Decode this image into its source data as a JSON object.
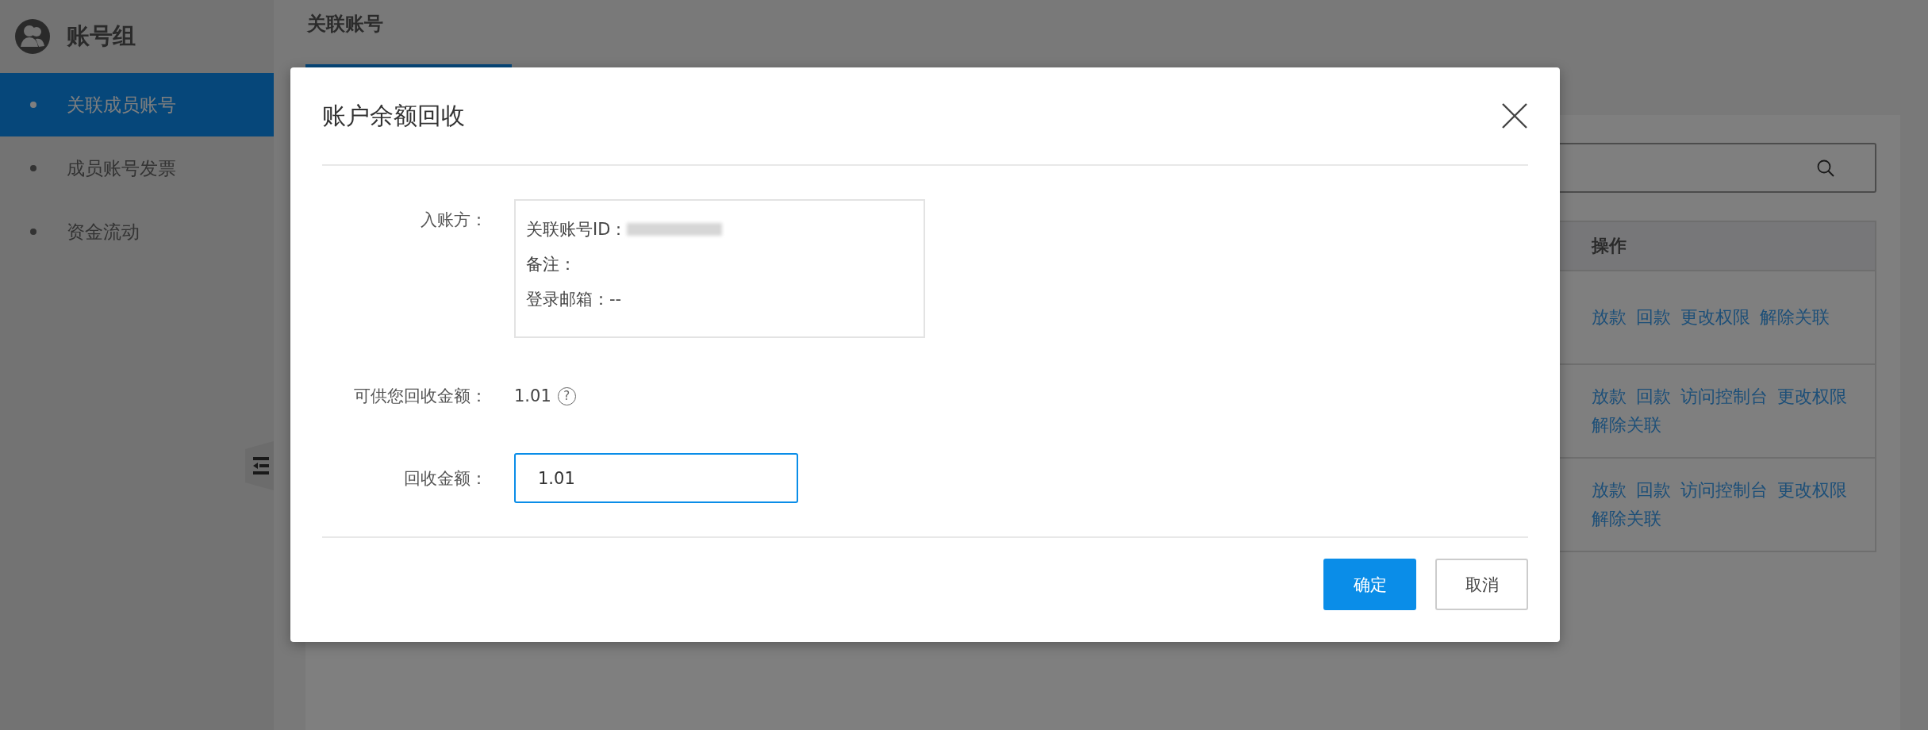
{
  "sidebar": {
    "title": "账号组",
    "items": [
      {
        "label": "关联成员账号",
        "selected": true
      },
      {
        "label": "成员账号发票",
        "selected": false
      },
      {
        "label": "资金流动",
        "selected": false
      }
    ]
  },
  "tabs": [
    {
      "label": "关联账号",
      "selected": true
    }
  ],
  "table": {
    "columns": [
      "操作"
    ],
    "rows": [
      {
        "actions": [
          "放款",
          "回款",
          "更改权限",
          "解除关联"
        ]
      },
      {
        "actions": [
          "放款",
          "回款",
          "访问控制台",
          "更改权限",
          "解除关联"
        ]
      },
      {
        "actions": [
          "放款",
          "回款",
          "访问控制台",
          "更改权限",
          "解除关联"
        ]
      }
    ]
  },
  "dialog": {
    "title": "账户余额回收",
    "fields": [
      {
        "kind": "info",
        "label": "入账方：",
        "lines": [
          {
            "text": "关联账号ID：",
            "redacted": true
          },
          {
            "text": "备注：",
            "redacted": false
          },
          {
            "text": "登录邮箱：--",
            "redacted": false
          }
        ]
      },
      {
        "kind": "amount",
        "label": "可供您回收金额：",
        "value": "1.01",
        "help_icon": "?"
      },
      {
        "kind": "input",
        "label": "回收金额：",
        "value": "1.01"
      }
    ],
    "buttons": [
      {
        "label": "确定",
        "kind": "primary"
      },
      {
        "label": "取消",
        "kind": "default"
      }
    ]
  }
}
